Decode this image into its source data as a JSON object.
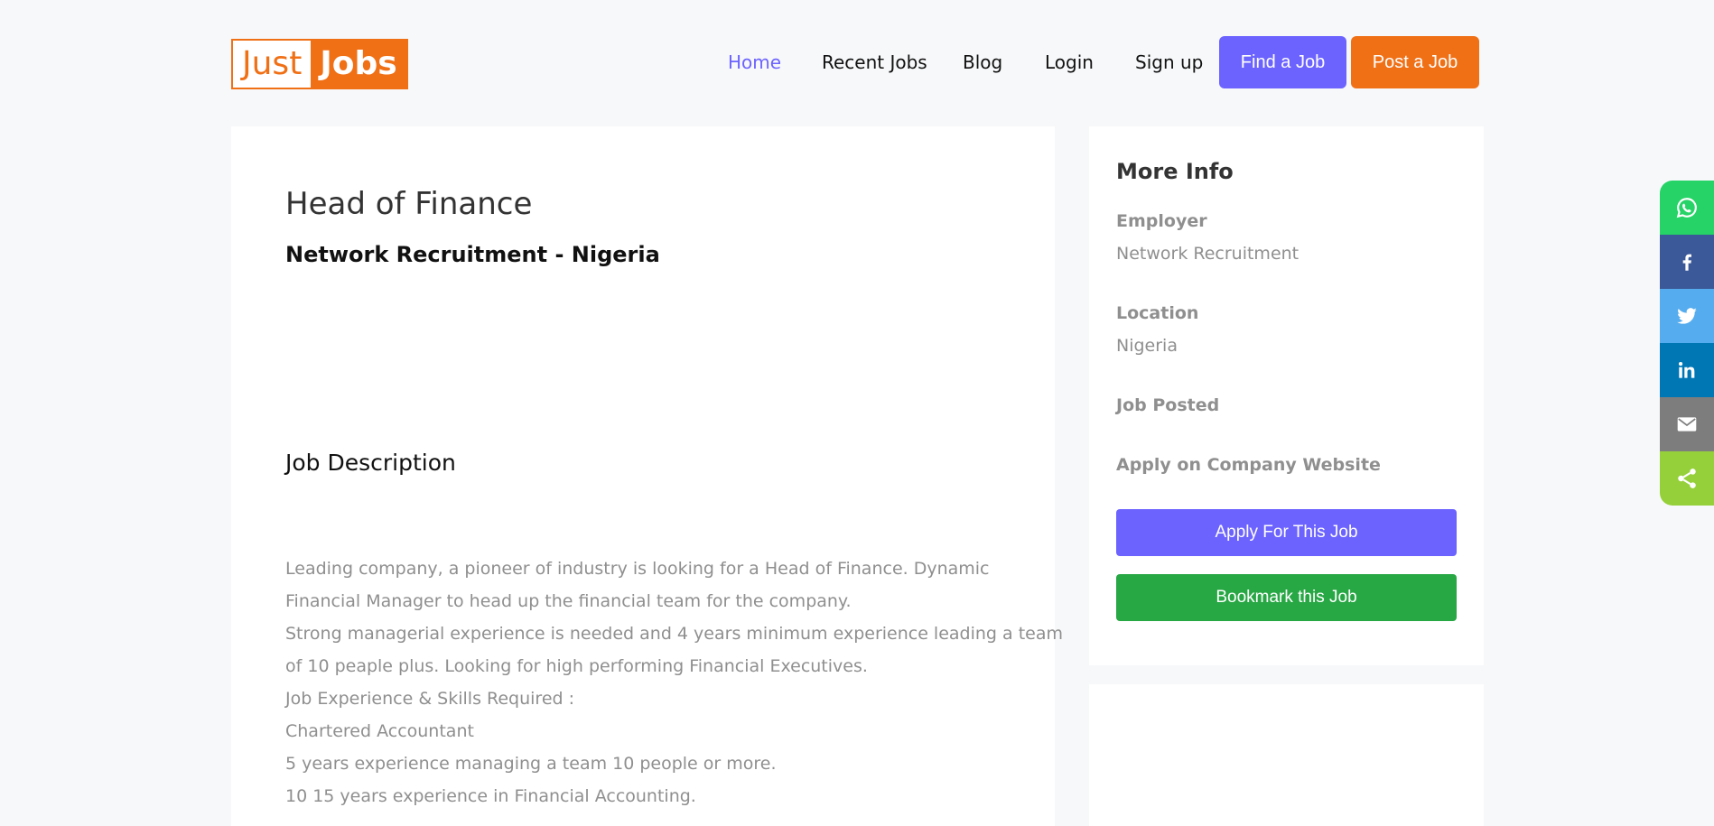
{
  "logo": {
    "part1": "Just",
    "part2": "Jobs"
  },
  "nav": {
    "items": [
      {
        "label": "Home",
        "active": true
      },
      {
        "label": "Recent Jobs",
        "active": false
      },
      {
        "label": "Blog",
        "active": false
      },
      {
        "label": "Login",
        "active": false
      },
      {
        "label": "Sign up",
        "active": false
      }
    ],
    "find_job": "Find a Job",
    "post_job": "Post a Job"
  },
  "job": {
    "title": "Head of Finance",
    "company_location": "Network Recruitment - Nigeria",
    "description_heading": "Job Description",
    "description_lines": [
      "Leading company, a pioneer of industry is looking for a Head of Finance. Dynamic",
      "Financial Manager to head up the financial team for the company.",
      "Strong managerial experience is needed and 4 years minimum experience leading a team",
      "of 10 peaple plus. Looking for high performing Financial Executives.",
      "Job Experience & Skills Required :",
      "Chartered Accountant",
      "5 years experience managing a team 10 people or more.",
      "10 15 years experience in Financial Accounting."
    ]
  },
  "sidebar": {
    "heading": "More Info",
    "employer_label": "Employer",
    "employer_value": "Network Recruitment",
    "location_label": "Location",
    "location_value": "Nigeria",
    "posted_label": "Job Posted",
    "apply_site_label": "Apply on Company Website",
    "apply_button": "Apply For This Job",
    "bookmark_button": "Bookmark this Job"
  },
  "share": [
    {
      "icon": "whatsapp-icon",
      "color": "#25d366"
    },
    {
      "icon": "facebook-icon",
      "color": "#3b5998"
    },
    {
      "icon": "twitter-icon",
      "color": "#55acee"
    },
    {
      "icon": "linkedin-icon",
      "color": "#0077b5"
    },
    {
      "icon": "email-icon",
      "color": "#7d7d7d"
    },
    {
      "icon": "share-icon",
      "color": "#95d03a"
    }
  ],
  "colors": {
    "accent": "#6c63ff",
    "brand_orange": "#f07016",
    "success": "#28a745"
  }
}
